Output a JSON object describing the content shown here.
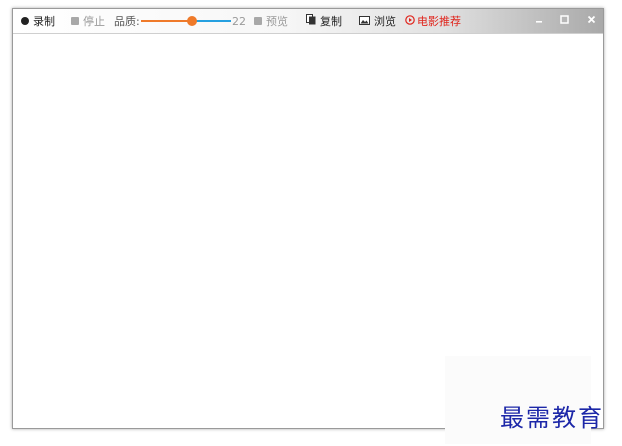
{
  "toolbar": {
    "record_label": "录制",
    "stop_label": "停止",
    "quality_label": "品质:",
    "quality_value": "22",
    "quality_level": 0.57,
    "preview_label": "预览",
    "copy_label": "复制",
    "browse_label": "浏览",
    "movie_label": "电影推荐"
  },
  "window_controls": {
    "minimize": "minimize-icon",
    "maximize": "maximize-icon",
    "close": "close-icon"
  },
  "watermark": {
    "text": "最需教育"
  },
  "colors": {
    "accent_red": "#e0241c",
    "slider_orange": "#ef7a2a",
    "slider_blue": "#26a0e0",
    "watermark_blue": "#1c27a8",
    "disabled_gray": "#9a9a9a"
  }
}
